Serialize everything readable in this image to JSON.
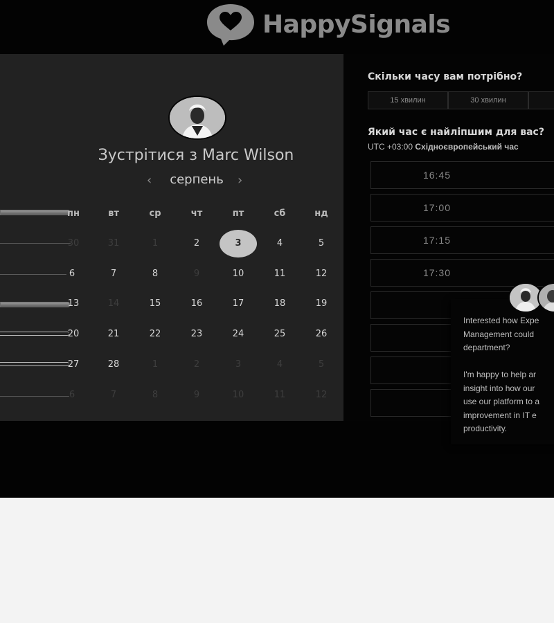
{
  "brand": {
    "name": "HappySignals",
    "logo_icon": "heart-speech-bubble-icon"
  },
  "meeting": {
    "title": "Зустрітися з Marc Wilson",
    "host_avatar": "avatar"
  },
  "calendar": {
    "month": "серпень",
    "prev_icon": "‹",
    "next_icon": "›",
    "weekdays": [
      "пн",
      "вт",
      "ср",
      "чт",
      "пт",
      "сб",
      "нд"
    ],
    "weeks": [
      [
        "30",
        "31",
        "1",
        "2",
        "3",
        "4",
        "5"
      ],
      [
        "6",
        "7",
        "8",
        "9",
        "10",
        "11",
        "12"
      ],
      [
        "13",
        "14",
        "15",
        "16",
        "17",
        "18",
        "19"
      ],
      [
        "20",
        "21",
        "22",
        "23",
        "24",
        "25",
        "26"
      ],
      [
        "27",
        "28",
        "1",
        "2",
        "3",
        "4",
        "5"
      ],
      [
        "6",
        "7",
        "8",
        "9",
        "10",
        "11",
        "12"
      ]
    ],
    "selected_day": "3"
  },
  "duration": {
    "heading": "Скільки часу вам потрібно?",
    "options": [
      "15 хвилин",
      "30 хвилин",
      ""
    ]
  },
  "time": {
    "heading": "Який час є найліпшим для вас?",
    "tz_offset": "UTC +03:00",
    "tz_name": "Східноєвропейський час",
    "slots": [
      "16:45",
      "17:00",
      "17:15",
      "17:30",
      "",
      "",
      "",
      ""
    ]
  },
  "chat": {
    "message": "Interested how Expe\nManagement could\ndepartment?\n\nI'm happy to help ar\ninsight into how our\nuse our platform to a\nimprovement in IT e\nproductivity."
  }
}
